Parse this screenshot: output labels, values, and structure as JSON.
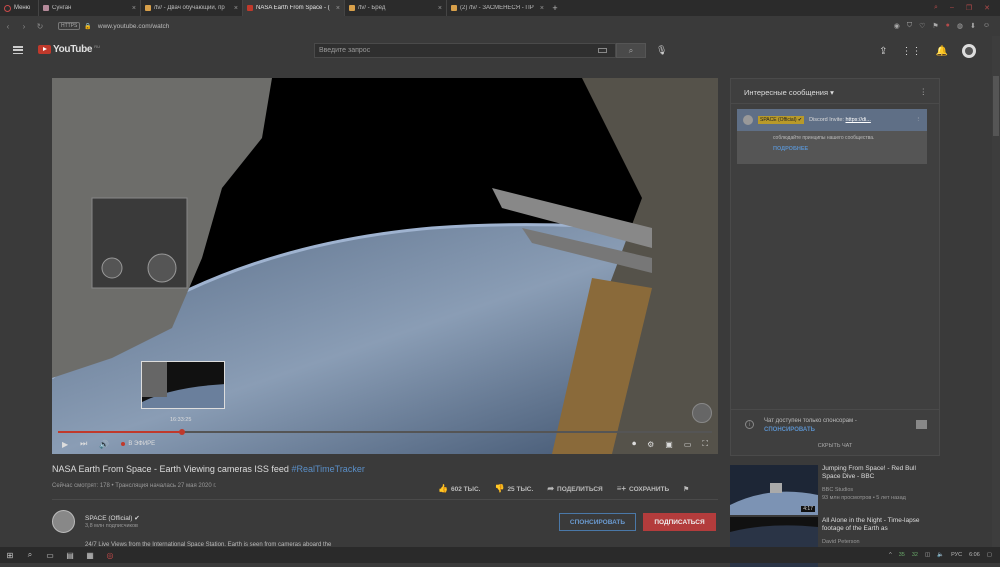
{
  "browser": {
    "menu_label": "Меню",
    "tabs": [
      {
        "title": "Сунган",
        "color": "#b58a9a",
        "active": false
      },
      {
        "title": "/tv/ - Двач обучающий, пр",
        "color": "#d8a04a",
        "active": false
      },
      {
        "title": "NASA Earth From Space - (",
        "color": "#c0392b",
        "active": true
      },
      {
        "title": "/tv/ - Бред",
        "color": "#d8a04a",
        "active": false
      },
      {
        "title": "(2) /tv/ - ЗАСМЕНЕСЯ - ПР",
        "color": "#d8a04a",
        "active": false
      }
    ],
    "close_glyph": "×",
    "newtab_glyph": "+",
    "address": "www.youtube.com/watch",
    "https_badge": "HTTPS"
  },
  "youtube": {
    "region": "RU",
    "logo_text": "YouTube",
    "search_placeholder": "Введите запрос"
  },
  "player": {
    "progress": 0.19,
    "preview_time": "16:33:25",
    "live_label": "В ЭФИРЕ"
  },
  "video": {
    "title": "NASA Earth From Space - Earth Viewing cameras ISS feed",
    "hashtag": "#RealTimeTracker",
    "meta": "Сейчас смотрят: 178 • Трансляция началась 27 мая 2020 г.",
    "likes": "602 ТЫС.",
    "dislikes": "25 ТЫС.",
    "share": "ПОДЕЛИТЬСЯ",
    "save": "СОХРАНИТЬ"
  },
  "channel": {
    "name": "SPACE (Official)",
    "subs": "3,8 млн подписчиков",
    "sponsor_label": "СПОНСИРОВАТЬ",
    "subscribe_label": "ПОДПИСАТЬСЯ",
    "description": "24/7 Live Views from the International Space Station. Earth is seen from cameras aboard the"
  },
  "chat": {
    "header": "Интересные сообщения",
    "pinned_badge": "SPACE (Official)",
    "pinned_text_prefix": "Discord Invite:",
    "pinned_link": "https://di...",
    "pinned_sub": "соблюдайте принципы нашего сообщества.",
    "more_label": "ПОДРОБНЕЕ",
    "footer_line1": "Чат доступен только спонсорам -",
    "footer_line2": "СПОНСИРОВАТЬ",
    "hide_label": "СКРЫТЬ ЧАТ"
  },
  "recommendations": [
    {
      "title": "Jumping From Space! - Red Bull Space Dive - BBC",
      "channel": "BBC Studios",
      "meta": "93 млн просмотров • 5 лет назад",
      "duration": "4:17"
    },
    {
      "title": "All Alone in the Night - Time-lapse footage of the Earth as",
      "channel": "David Peterson",
      "meta": "",
      "duration": ""
    }
  ],
  "taskbar": {
    "lang": "РУС",
    "time": "6:06",
    "tray1": "35",
    "tray2": "32"
  },
  "colors": {
    "accent_red": "#c0392b",
    "link_blue": "#5a8fc8",
    "owner_gold": "#b89a2a"
  }
}
